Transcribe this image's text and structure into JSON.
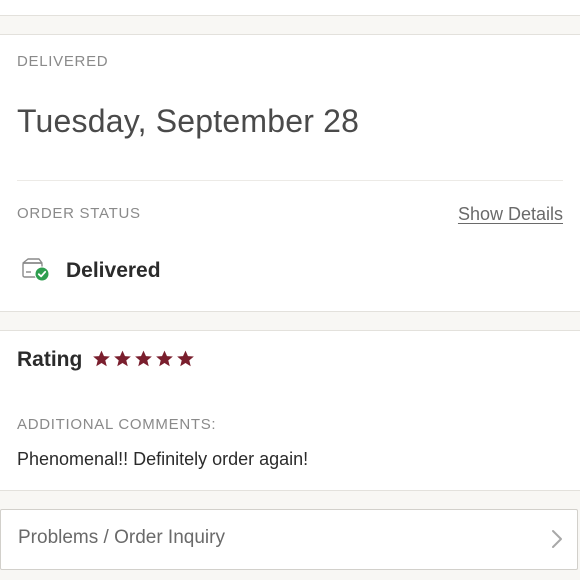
{
  "delivery": {
    "section_label": "DELIVERED",
    "date": "Tuesday, September 28"
  },
  "order_status": {
    "section_label": "ORDER STATUS",
    "show_details_label": "Show Details",
    "status_text": "Delivered",
    "status_icon": "package-delivered-icon",
    "status_icon_check_color": "#2e9e4f"
  },
  "rating": {
    "label": "Rating",
    "stars_value": 5,
    "stars_max": 5,
    "star_color": "#7a1f2e"
  },
  "comments": {
    "section_label": "ADDITIONAL COMMENTS:",
    "text": "Phenomenal!! Definitely order again!"
  },
  "inquiry": {
    "label": "Problems / Order Inquiry",
    "icon": "chevron-right-icon"
  }
}
